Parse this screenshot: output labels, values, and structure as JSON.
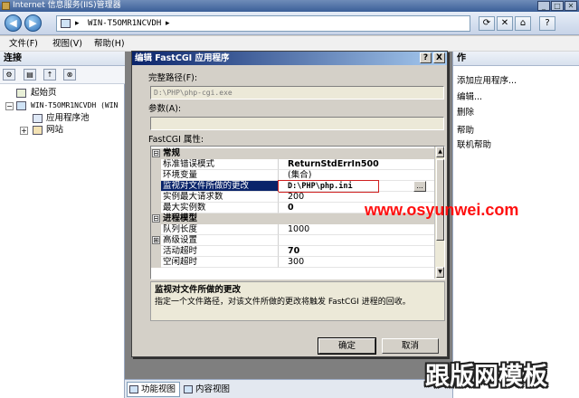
{
  "window": {
    "title": "Internet 信息服务(IIS)管理器",
    "controls": [
      "_",
      "□",
      "✕"
    ]
  },
  "address": {
    "breadcrumb": "WIN-T5OMR1NCVDH",
    "separator1": "◂",
    "separator2": "▸"
  },
  "menu": {
    "items": [
      "文件(F)",
      "视图(V)",
      "帮助(H)"
    ]
  },
  "connections": {
    "header": "连接",
    "tree": [
      {
        "label": "起始页",
        "icon": "start-page-icon"
      },
      {
        "label": "WIN-T5OMR1NCVDH (WIN",
        "icon": "server-icon"
      },
      {
        "label": "应用程序池",
        "icon": "app-pool-icon"
      },
      {
        "label": "网站",
        "icon": "sites-icon"
      }
    ]
  },
  "actions": {
    "header": "作",
    "links": [
      "添加应用程序...",
      "编辑...",
      "删除",
      "帮助",
      "联机帮助"
    ]
  },
  "bottom_tabs": [
    "功能视图",
    "内容视图"
  ],
  "dialog": {
    "title": "编辑 FastCGI 应用程序",
    "help_button": "?",
    "close_button": "X",
    "full_path_label": "完整路径(F):",
    "full_path_value": "D:\\PHP\\php-cgi.exe",
    "arguments_label": "参数(A):",
    "arguments_value": "",
    "properties_label": "FastCGI 属性:",
    "grid": {
      "cat1": "常规",
      "cat2": "进程模型",
      "rows1": [
        {
          "name": "标准错误模式",
          "value": "ReturnStdErrIn500"
        },
        {
          "name": "环境变量",
          "value": "(集合)"
        },
        {
          "name": "监视对文件所做的更改",
          "value": "D:\\PHP\\php.ini"
        },
        {
          "name": "实例最大请求数",
          "value": "200"
        },
        {
          "name": "最大实例数",
          "value": "0"
        }
      ],
      "rows2": [
        {
          "name": "队列长度",
          "value": "1000"
        },
        {
          "name": "高级设置",
          "value": ""
        },
        {
          "name": "活动超时",
          "value": "70"
        },
        {
          "name": "空闲超时",
          "value": "300"
        }
      ],
      "expand_minus": "⊟",
      "expand_plus": "⊞",
      "ellipsis": "..."
    },
    "description_title": "监视对文件所做的更改",
    "description_text": "指定一个文件路径，对该文件所做的更改将触发 FastCGI 进程的回收。",
    "ok_label": "确定",
    "cancel_label": "取消"
  },
  "watermark_url": "www.osyunwei.com",
  "watermark_logo": "跟版网模板"
}
